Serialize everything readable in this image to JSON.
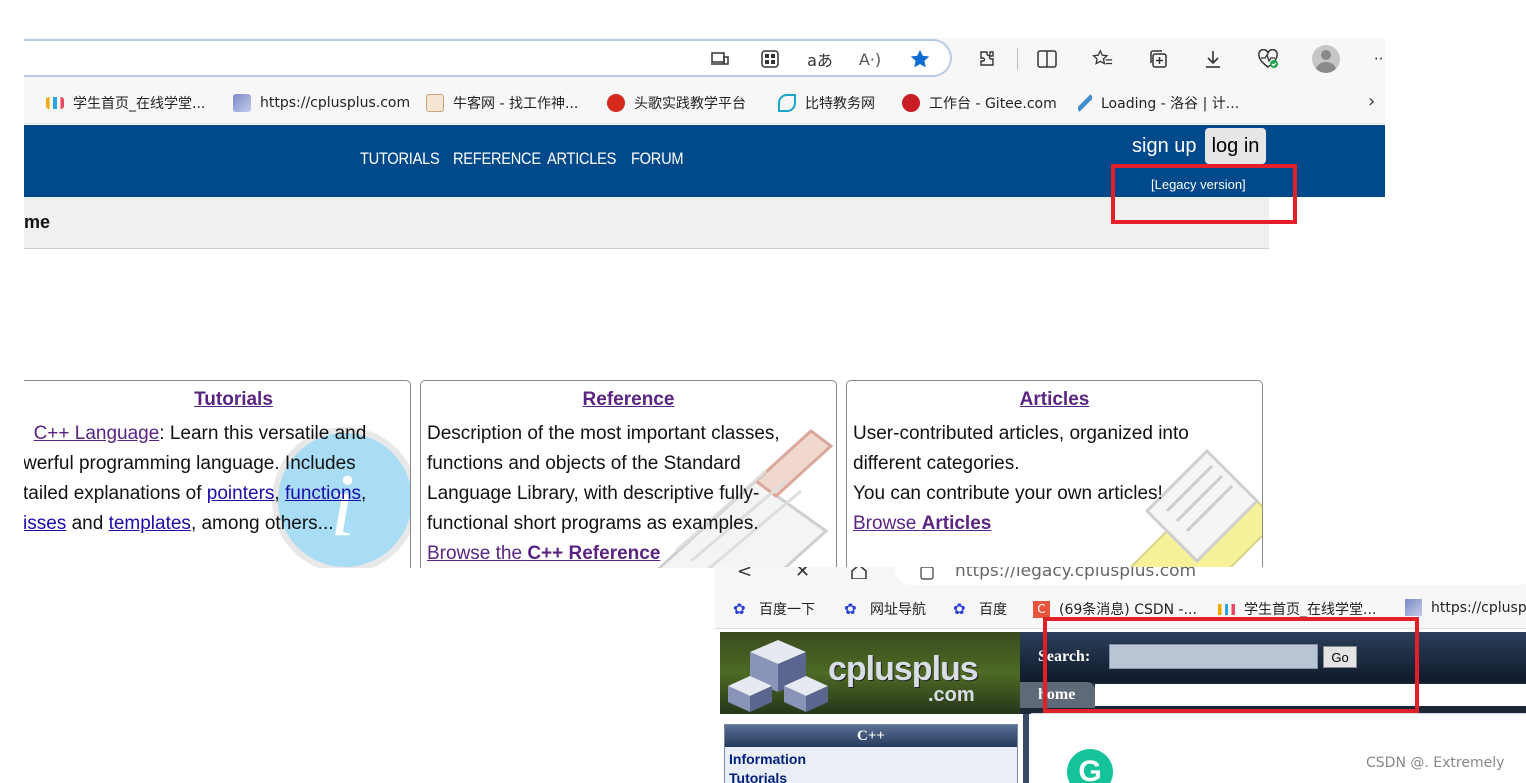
{
  "top_browser": {
    "toolbar_icons": [
      "device-icon",
      "apps-icon",
      "translate-icon",
      "read-aloud-icon",
      "favorite-star-icon",
      "extensions-icon",
      "split-screen-icon",
      "favorites-icon",
      "collections-icon",
      "downloads-icon",
      "browser-health-icon",
      "profile-avatar",
      "more-icon"
    ],
    "translate_glyph": "aあ",
    "read_aloud_glyph": "A·)",
    "more_glyph": "···",
    "bookmarks": [
      "学生首页_在线学堂...",
      "https://cplusplus.com",
      "牛客网 - 找工作神...",
      "头歌实践教学平台",
      "比特教务网",
      "工作台 - Gitee.com",
      "Loading - 洛谷 | 计..."
    ],
    "bookmarks_more": "›"
  },
  "top_site": {
    "nav": [
      "TUTORIALS",
      "REFERENCE",
      "ARTICLES",
      "FORUM"
    ],
    "sign_up": "sign up",
    "log_in": "log in",
    "legacy": "[Legacy version]",
    "breadcrumb": "me",
    "colors": {
      "nav_bg": "#00498a",
      "link_purple": "#5a2483",
      "link_blue": "#1a0dab",
      "highlight_red": "#e3202a"
    },
    "cards": [
      {
        "title": "Tutorials",
        "lines": {
          "l1_link": "C++ Language",
          "l1_rest": ": Learn this versatile and",
          "l2": "werful programming language. Includes",
          "l3_pre": "tailed explanations of ",
          "l3_link1": "pointers",
          "l3_sep": ", ",
          "l3_link2": "functions",
          "l3_end": ",",
          "l4_link1": "isses",
          "l4_mid": " and ",
          "l4_link2": "templates",
          "l4_end": ", among others..."
        }
      },
      {
        "title": "Reference",
        "lines": {
          "l1": "Description of the most important classes,",
          "l2": "functions and objects of the Standard",
          "l3": "Language Library, with descriptive fully-",
          "l4": "functional short programs as examples.",
          "link_pre": "Browse the ",
          "link_bold": "C++ Reference"
        }
      },
      {
        "title": "Articles",
        "lines": {
          "l1": "User-contributed articles, organized into",
          "l2": "different categories.",
          "l3": "You can contribute your own articles!",
          "link_pre": "Browse ",
          "link_bold": "Articles"
        }
      }
    ]
  },
  "legacy_browser": {
    "url": "https://legacy.cplusplus.com",
    "controls": [
      "back-icon",
      "close-icon",
      "home-icon",
      "tab-icon"
    ],
    "back_glyph": "<",
    "close_glyph": "✕",
    "bookmarks": [
      "百度一下",
      "网址导航",
      "百度",
      "(69条消息) CSDN -...",
      "学生首页_在线学堂...",
      "https://cplusp"
    ]
  },
  "legacy_site": {
    "logo": "cplusplus",
    "logo_com": ".com",
    "search_label": "Search:",
    "search_value": "",
    "go": "Go",
    "home": "home",
    "sidebar_head": "C++",
    "sidebar_items": [
      "Information",
      "Tutorials"
    ],
    "grammarly_glyph": "G"
  },
  "watermark": "CSDN @. Extremely"
}
